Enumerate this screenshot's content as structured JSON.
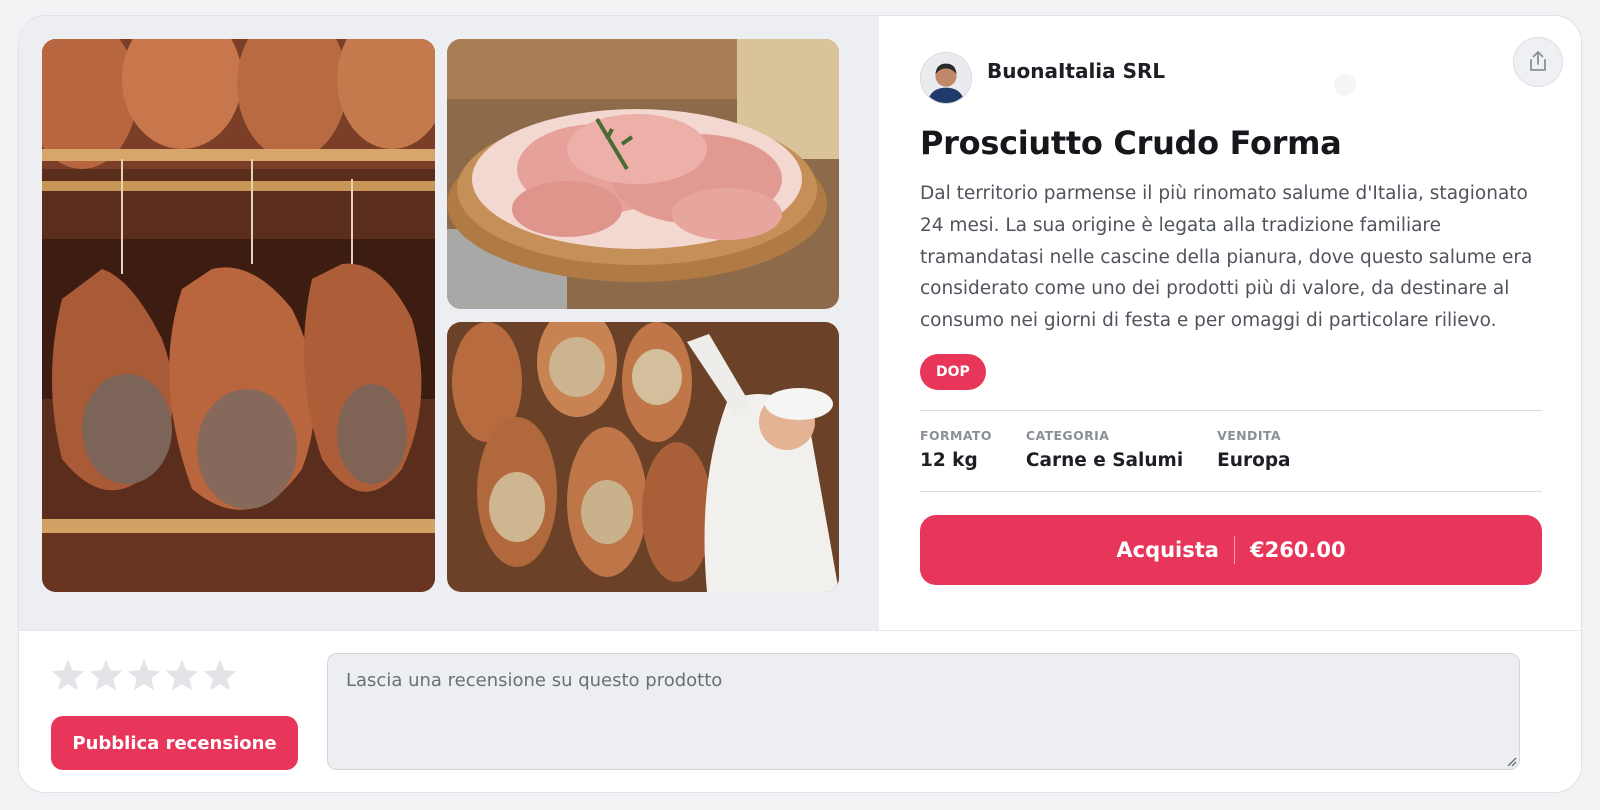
{
  "seller": {
    "name": "BuonaItalia SRL"
  },
  "product": {
    "title": "Prosciutto Crudo Forma",
    "description": "Dal territorio parmense il più rinomato salume d'Italia, stagionato 24 mesi. La sua origine è legata alla tradizione familiare tramandatasi nelle cascine della pianura, dove questo salume era considerato come uno dei prodotti più di valore, da destinare al consumo nei giorni di festa e per omaggi di particolare rilievo.",
    "badge": "DOP",
    "specs": [
      {
        "label": "FORMATO",
        "value": "12 kg"
      },
      {
        "label": "CATEGORIA",
        "value": "Carne e Salumi"
      },
      {
        "label": "VENDITA",
        "value": "Europa"
      }
    ]
  },
  "buy": {
    "label": "Acquista",
    "price": "€260.00"
  },
  "review": {
    "rating": 0,
    "max_rating": 5,
    "placeholder": "Lascia una recensione su questo prodotto",
    "publish_label": "Pubblica recensione"
  },
  "colors": {
    "accent": "#e8365b",
    "star_empty": "#e3e4e8"
  },
  "icons": {
    "share": "share-icon",
    "star": "star-icon",
    "resize": "resize-grip-icon"
  }
}
